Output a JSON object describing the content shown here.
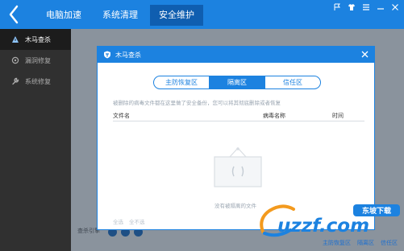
{
  "topbar": {
    "tabs": [
      "电脑加速",
      "系统清理",
      "安全维护"
    ],
    "active_tab": 2
  },
  "sidebar": {
    "items": [
      {
        "label": "木马查杀",
        "icon": "hazard-icon",
        "active": true
      },
      {
        "label": "漏洞修复",
        "icon": "repair-icon",
        "active": false
      },
      {
        "label": "系统修复",
        "icon": "wrench-icon",
        "active": false
      }
    ]
  },
  "main": {
    "footer_text": "查杀引擎"
  },
  "dialog": {
    "title": "木马查杀",
    "segments": [
      "主防恢复区",
      "隔离区",
      "信任区"
    ],
    "active_segment": 1,
    "hint": "被删除的病毒文件都在这里做了安全备份，您可以将其彻底删除或者恢复",
    "columns": [
      "文件名",
      "病毒名称",
      "时间"
    ],
    "empty_text": "没有被隔离的文件",
    "select_all": "全选",
    "select_none": "全不选"
  },
  "bottom_links": [
    "主防恢复区",
    "隔离区",
    "信任区"
  ],
  "watermark": {
    "logo_text": "uzzf.com",
    "badge_text": "东坡下载"
  },
  "colors": {
    "accent": "#1c82e0",
    "sidebar_bg": "#303030",
    "dim_bg": "#8a939d"
  }
}
